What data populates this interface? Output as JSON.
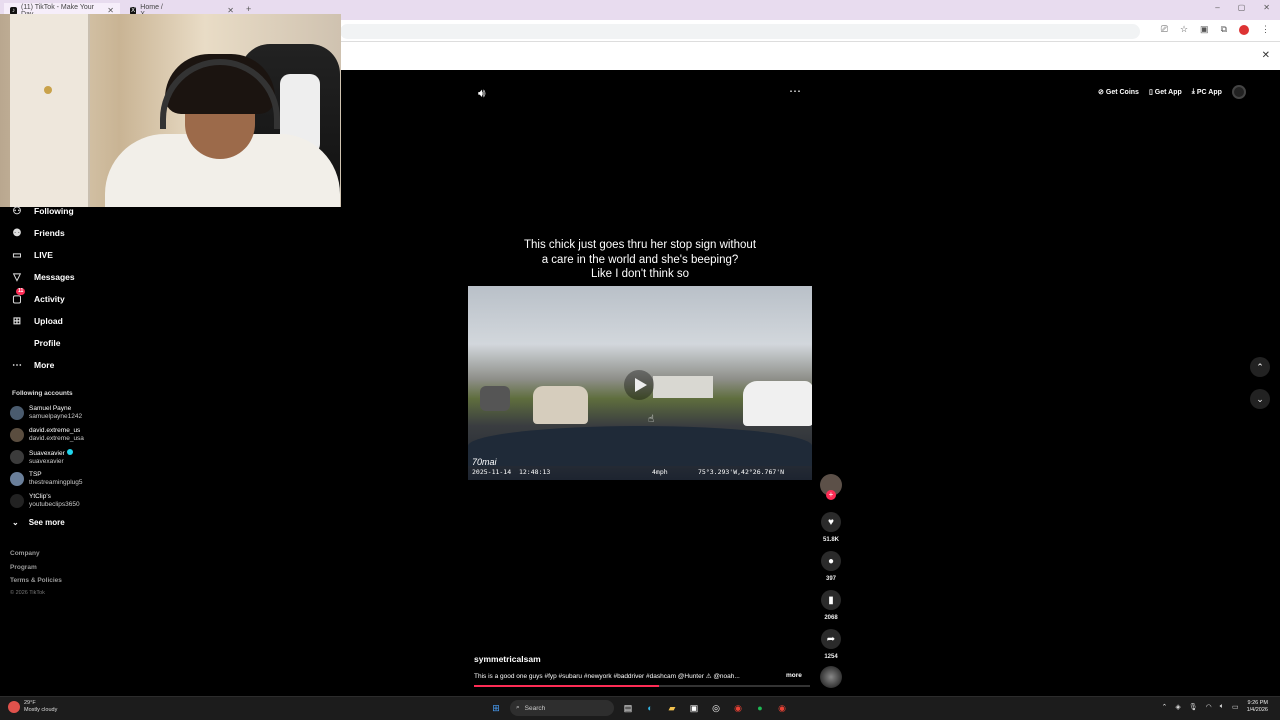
{
  "browser": {
    "tabs": [
      {
        "title": "(11) TikTok - Make Your Day"
      },
      {
        "title": "Home / X"
      }
    ],
    "new_tab": "+",
    "window_controls": [
      "–",
      "▢",
      "✕"
    ]
  },
  "sidebar": {
    "items": [
      {
        "label": "Following",
        "icon": "following-icon"
      },
      {
        "label": "Friends",
        "icon": "friends-icon"
      },
      {
        "label": "LIVE",
        "icon": "live-icon"
      },
      {
        "label": "Messages",
        "icon": "messages-icon"
      },
      {
        "label": "Activity",
        "icon": "activity-icon",
        "badge": "11"
      },
      {
        "label": "Upload",
        "icon": "upload-icon"
      },
      {
        "label": "Profile",
        "icon": "profile-icon"
      },
      {
        "label": "More",
        "icon": "more-icon"
      }
    ],
    "following_header": "Following accounts",
    "accounts": [
      {
        "name": "Samuel Payne",
        "username": "samuelpayne1242"
      },
      {
        "name": "david.extreme_us",
        "username": "david.extreme_usa"
      },
      {
        "name": "Suavexavier",
        "username": "suavexavier",
        "verified": true
      },
      {
        "name": "TSP",
        "username": "thestreamingplug5"
      },
      {
        "name": "YtClip's",
        "username": "youtubeclips3650"
      }
    ],
    "see_more": "See more",
    "footer": [
      "Company",
      "Program",
      "Terms & Policies"
    ],
    "copyright": "© 2026 TikTok"
  },
  "topright": {
    "get_coins": "Get Coins",
    "get_app": "Get App",
    "pc_app": "PC App"
  },
  "video": {
    "caption_lines": [
      "This chick just goes thru her stop sign without",
      "a care in the world and she's beeping?",
      "Like I don't think so"
    ],
    "dashcam_brand": "70mai",
    "dashcam_timestamp": "2025-11-14  12:48:13",
    "dashcam_speed": "4mph",
    "dashcam_gps": "75°3.293'W,42°26.767'N",
    "progress": 0.55
  },
  "actions": {
    "likes": "51.8K",
    "comments": "397",
    "saves": "2068",
    "shares": "1254"
  },
  "post": {
    "author": "symmetricalsam",
    "description": "This is a good one guys #fyp #subaru #newyork #baddriver #dashcam @Hunter ⚠ @noah...",
    "more": "more"
  },
  "taskbar": {
    "weather_temp": "29°F",
    "weather_desc": "Mostly cloudy",
    "search_placeholder": "Search",
    "time": "9:26 PM",
    "date": "1/4/2026"
  },
  "colors": {
    "accent": "#fe2c55",
    "verified": "#20d5ec"
  }
}
